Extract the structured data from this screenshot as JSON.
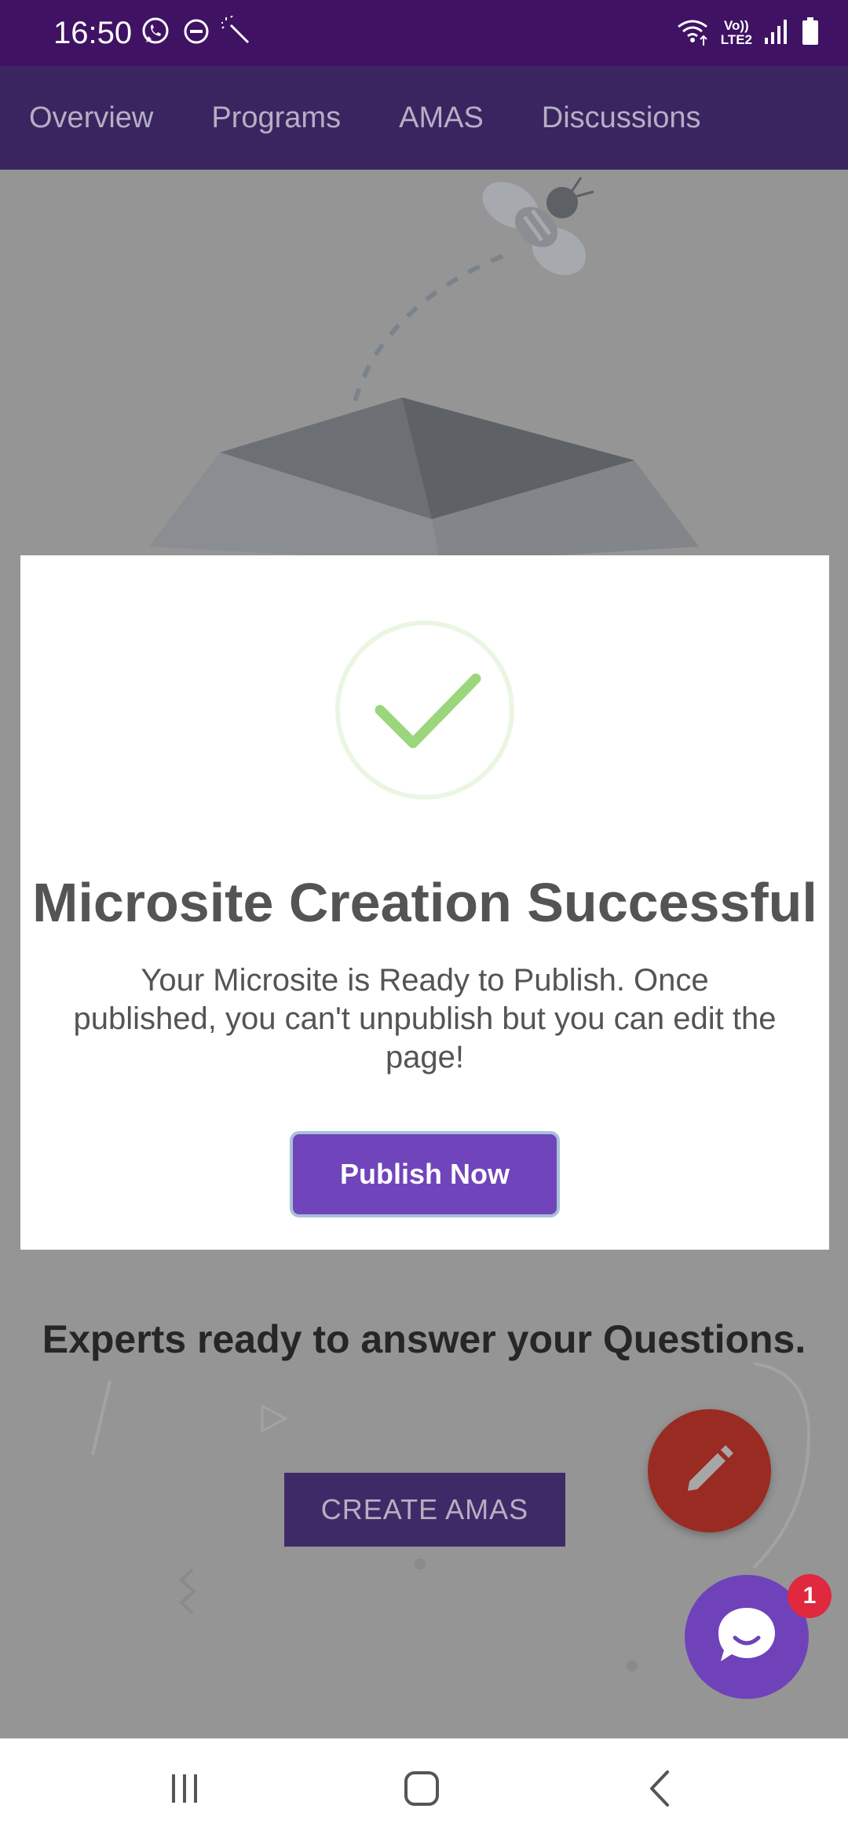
{
  "status_bar": {
    "time": "16:50",
    "left_icons": [
      "whatsapp-icon",
      "dnd-icon",
      "magic-wand-icon"
    ],
    "right_icons": [
      "wifi-calling-icon",
      "volte-icon",
      "signal-icon",
      "battery-icon"
    ],
    "volte_label_top": "Vo))",
    "volte_label_bottom": "LTE2"
  },
  "tabs": [
    {
      "label": "Overview"
    },
    {
      "label": "Programs"
    },
    {
      "label": "AMAS"
    },
    {
      "label": "Discussions"
    }
  ],
  "background": {
    "heading": "Experts ready to answer your Questions.",
    "create_button_label": "CREATE AMAS"
  },
  "modal": {
    "icon": "success-check-icon",
    "title": "Microsite Creation Successful",
    "message": "Your Microsite is Ready to Publish. Once published, you can't unpublish but you can edit the page!",
    "publish_label": "Publish Now"
  },
  "fabs": {
    "edit_icon": "pencil-icon",
    "chat_icon": "chat-icon",
    "chat_badge": "1"
  },
  "nav_bar": {
    "buttons": [
      "recent-apps-icon",
      "home-icon",
      "back-icon"
    ]
  },
  "colors": {
    "status_bar": "#3f1263",
    "tab_bar": "#3a2560",
    "overlay_background": "#959595",
    "primary_purple": "#7044bb",
    "edit_fab": "#9a2b22",
    "badge": "#e0283f",
    "success_green": "#9bd67c"
  }
}
